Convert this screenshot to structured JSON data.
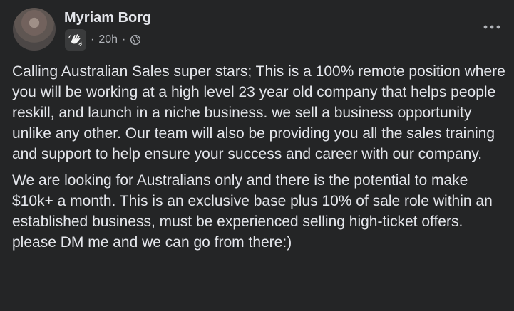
{
  "post": {
    "author_name": "Myriam Borg",
    "timestamp": "20h",
    "meta_separator_1": "·",
    "meta_separator_2": "·",
    "audience_icon": "globe-icon",
    "group_badge_icon": "waving-hand-icon",
    "more_options_icon": "more-options-icon",
    "paragraphs": [
      "Calling Australian Sales super stars; This is a 100% remote position where you will be working at a high level 23 year old company that helps people reskill, and launch in a niche business. we sell a business opportunity unlike any other. Our team will also be providing you all the sales training and support to help ensure your success and career with our company.",
      "We are looking for Australians only and there is the potential to make $10k+ a month. This is an exclusive base plus 10% of sale role within an established business, must be experienced selling high-ticket offers. please DM me and we can go from there:)"
    ]
  },
  "colors": {
    "background": "#242526",
    "primary_text": "#e4e6eb",
    "secondary_text": "#b0b3b8",
    "badge_background": "#3a3b3c"
  }
}
